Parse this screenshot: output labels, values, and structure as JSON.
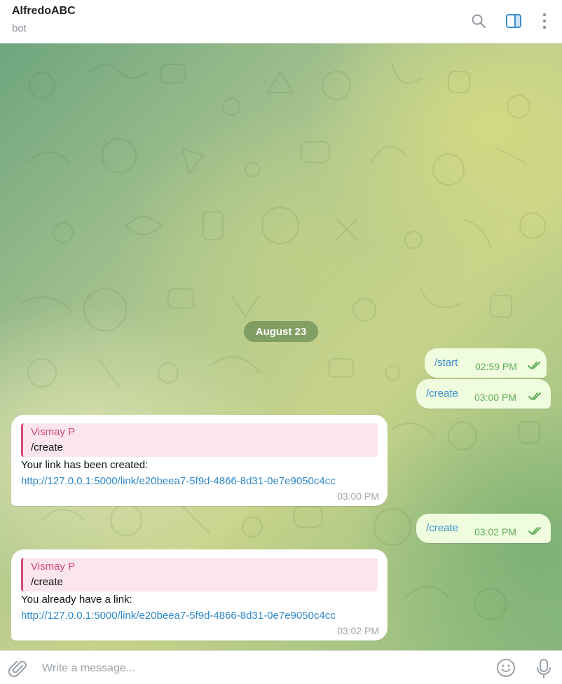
{
  "header": {
    "title": "AlfredoABC",
    "subtitle": "bot",
    "icons": [
      "search-icon",
      "side-panel-icon",
      "more-vertical-icon"
    ]
  },
  "chat": {
    "date_separator": "August 23",
    "messages": [
      {
        "direction": "outgoing",
        "text": "/start",
        "time": "02:59 PM",
        "status": "read"
      },
      {
        "direction": "outgoing",
        "text": "/create",
        "time": "03:00 PM",
        "status": "read"
      },
      {
        "direction": "incoming",
        "reply_to_name": "Vismay P",
        "reply_to_text": "/create",
        "text": "Your link has been created:",
        "link": "http://127.0.0.1:5000/link/e20beea7-5f9d-4866-8d31-0e7e9050c4cc",
        "time": "03:00 PM"
      },
      {
        "direction": "outgoing",
        "text": "/create",
        "time": "03:02 PM",
        "status": "read"
      },
      {
        "direction": "incoming",
        "reply_to_name": "Vismay P",
        "reply_to_text": "/create",
        "text": "You already have a link:",
        "link": "http://127.0.0.1:5000/link/e20beea7-5f9d-4866-8d31-0e7e9050c4cc",
        "time": "03:02 PM"
      }
    ]
  },
  "composer": {
    "placeholder": "Write a message...",
    "icons": [
      "paperclip-icon",
      "emoji-icon",
      "microphone-icon"
    ]
  },
  "colors": {
    "outgoing_bubble": "#effdde",
    "outgoing_time": "#5fab58",
    "command_text": "#3a8fd0",
    "link": "#2f88c9",
    "reply_accent": "#d24c7a",
    "icon_active": "#3a8fd0"
  }
}
